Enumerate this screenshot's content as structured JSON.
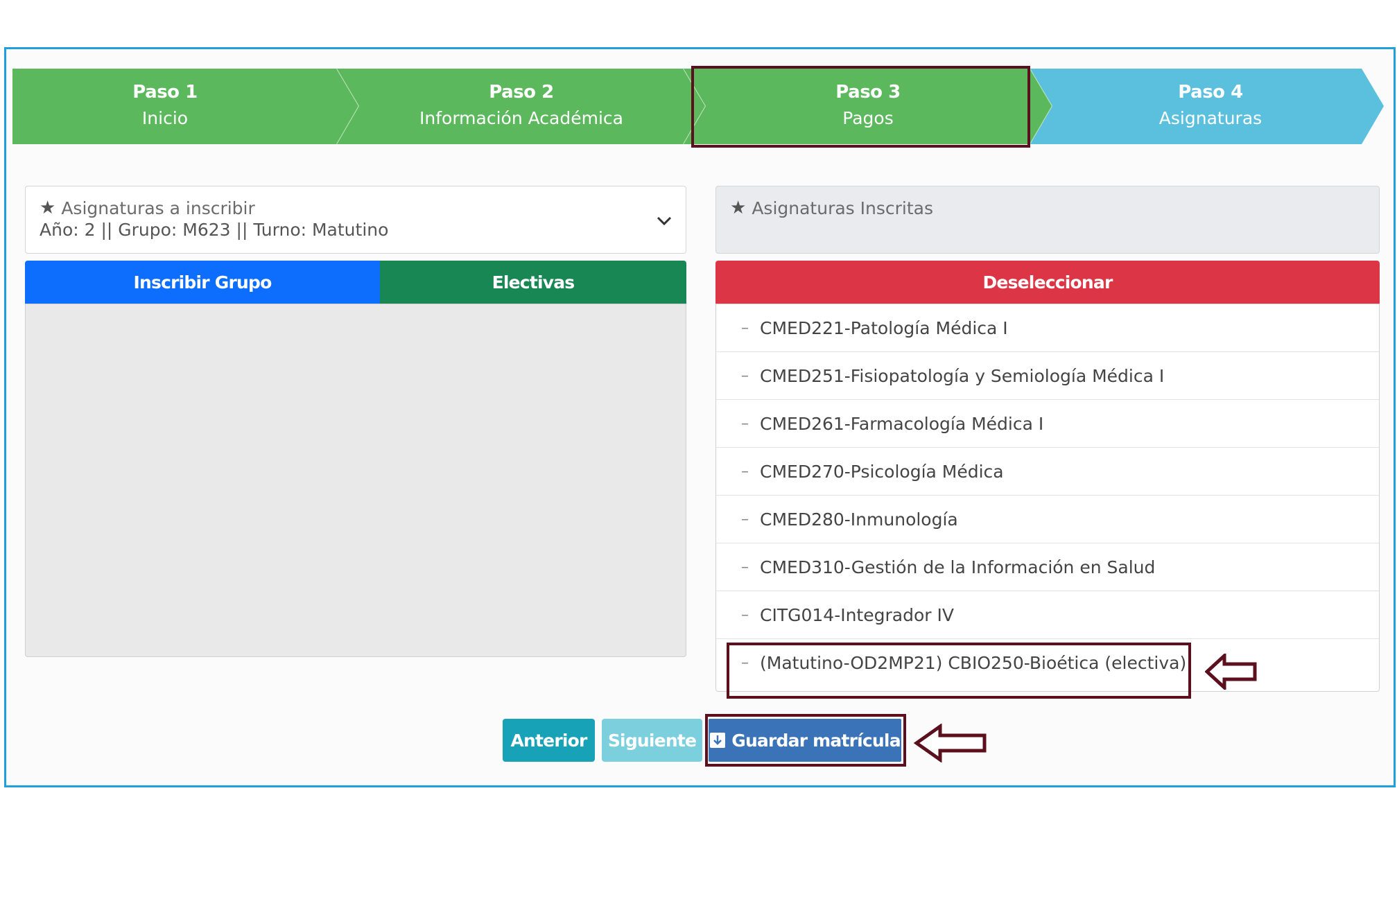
{
  "steps": [
    {
      "title": "Paso 1",
      "subtitle": "Inicio"
    },
    {
      "title": "Paso 2",
      "subtitle": "Información Académica"
    },
    {
      "title": "Paso 3",
      "subtitle": "Pagos"
    },
    {
      "title": "Paso 4",
      "subtitle": "Asignaturas"
    }
  ],
  "colors": {
    "step_done": "#5cb85c",
    "step_next": "#5bc0de",
    "primary": "#0d6efd",
    "success": "#198754",
    "danger": "#dc3545",
    "info": "#17a2b8",
    "highlight": "#5c0f1c"
  },
  "left_panel": {
    "title": "Asignaturas a inscribir",
    "subtitle": "Año: 2 || Grupo: M623 || Turno: Matutino",
    "buttons": {
      "inscribir": "Inscribir Grupo",
      "electivas": "Electivas"
    }
  },
  "right_panel": {
    "title": "Asignaturas Inscritas",
    "deselect": "Deseleccionar",
    "items": [
      "CMED221-Patología Médica I",
      "CMED251-Fisiopatología y Semiología Médica I",
      "CMED261-Farmacología Médica I",
      "CMED270-Psicología Médica",
      "CMED280-Inmunología",
      "CMED310-Gestión de la Información en Salud",
      "CITG014-Integrador IV",
      "(Matutino-OD2MP21) CBIO250-Bioética (electiva)"
    ]
  },
  "footer": {
    "anterior": "Anterior",
    "siguiente": "Siguiente",
    "guardar": "Guardar matrícula"
  }
}
